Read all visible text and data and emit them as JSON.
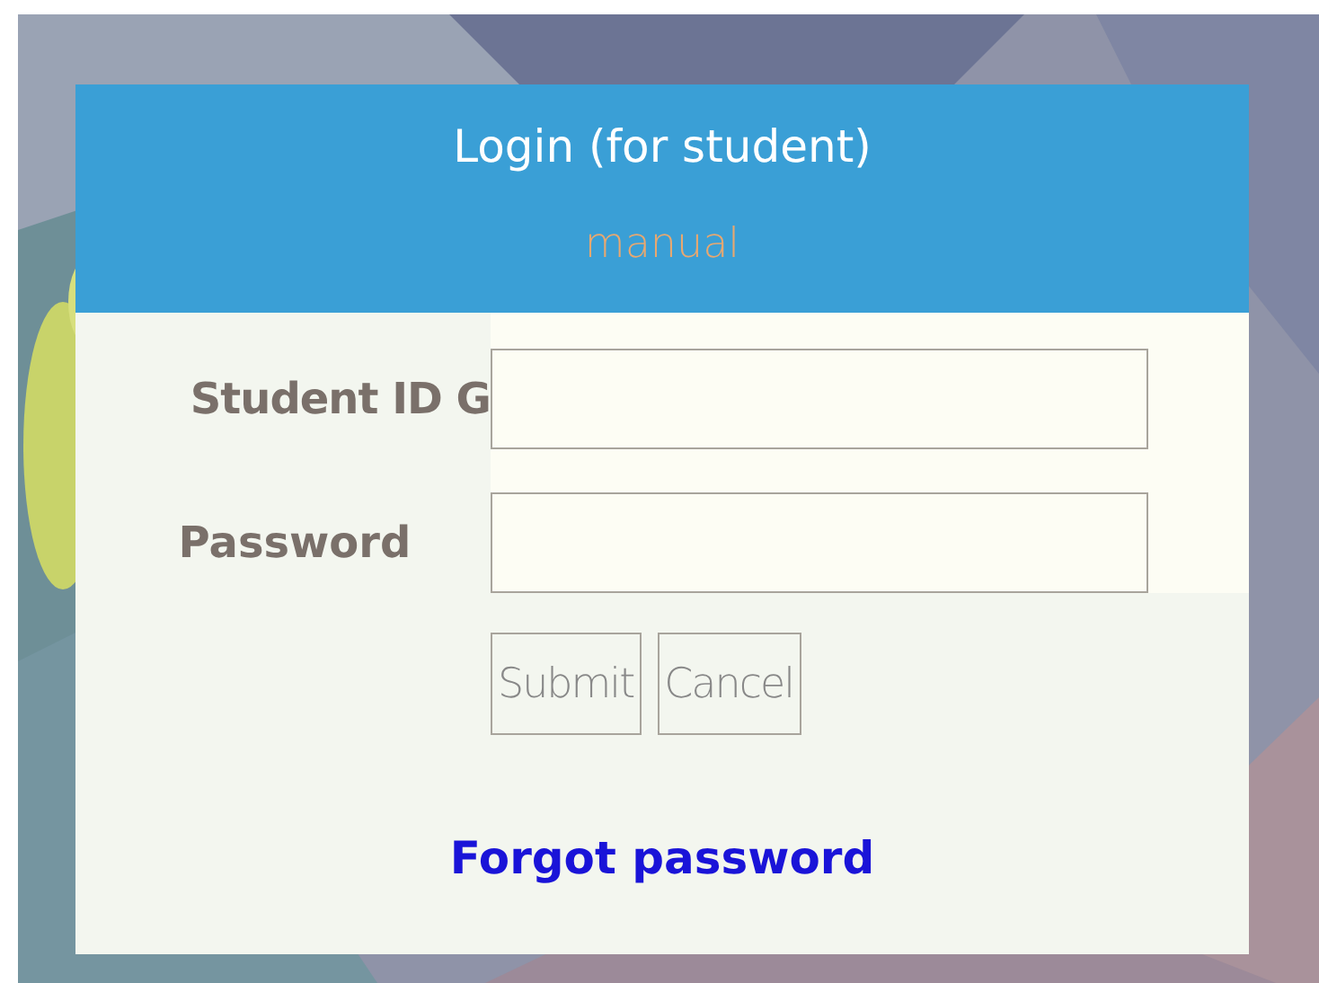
{
  "dialog": {
    "title": "Login (for student)",
    "subtitle": "manual"
  },
  "fields": [
    {
      "label": "Student ID G"
    },
    {
      "label": "Password"
    }
  ],
  "buttons": [
    "Submit",
    "Cancel"
  ],
  "link": "Forgot password"
}
